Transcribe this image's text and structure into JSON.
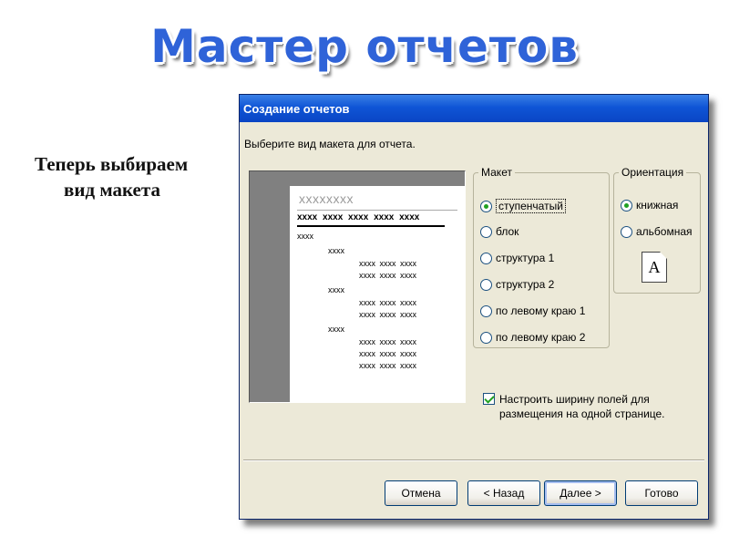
{
  "slide": {
    "title": "Мастер отчетов",
    "caption_line1": "Теперь выбираем",
    "caption_line2": "вид макета"
  },
  "dialog": {
    "title": "Создание отчетов",
    "prompt": "Выберите вид макета для отчета.",
    "preview": {
      "title": "xxxxxxxx",
      "header": "xxxx xxxx xxxx xxxx xxxx",
      "rows": [
        "xxxx",
        "xxxx",
        "xxxx xxxx xxxx",
        "xxxx xxxx xxxx",
        "xxxx",
        "xxxx xxxx xxxx",
        "xxxx xxxx xxxx",
        "xxxx",
        "xxxx xxxx xxxx",
        "xxxx xxxx xxxx",
        "xxxx xxxx xxxx"
      ]
    },
    "layout_group": {
      "label": "Макет",
      "options": [
        {
          "label": "ступенчатый",
          "selected": true
        },
        {
          "label": "блок",
          "selected": false
        },
        {
          "label": "структура 1",
          "selected": false
        },
        {
          "label": "структура 2",
          "selected": false
        },
        {
          "label": "по левому краю 1",
          "selected": false
        },
        {
          "label": "по левому краю 2",
          "selected": false
        }
      ]
    },
    "orientation_group": {
      "label": "Ориентация",
      "options": [
        {
          "label": "книжная",
          "selected": true
        },
        {
          "label": "альбомная",
          "selected": false
        }
      ],
      "page_icon_letter": "A"
    },
    "fit_checkbox": {
      "label": "Настроить ширину полей для размещения на одной странице.",
      "checked": true
    },
    "buttons": {
      "cancel": "Отмена",
      "back": "< Назад",
      "next": "Далее >",
      "finish": "Готово"
    }
  },
  "colors": {
    "title_blue": "#2f63d8",
    "titlebar_blue": "#0f55d6",
    "dialog_bg": "#ece9d8",
    "radio_green": "#21a121"
  }
}
